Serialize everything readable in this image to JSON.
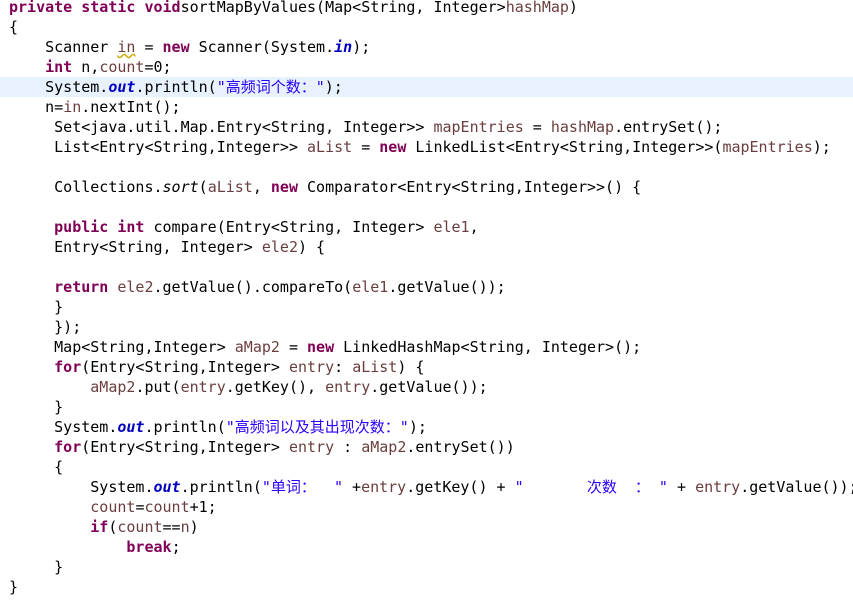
{
  "editor": {
    "current_line_index": 4,
    "colors": {
      "background": "#ffffff",
      "current_line_highlight": "#e8f2fe",
      "keyword": "#7f0055",
      "local_variable": "#6a3e3e",
      "static_field": "#0000c0",
      "string": "#2a00ff",
      "default_text": "#000000",
      "warning_underline": "#c9a800"
    },
    "lines": [
      [
        [
          "kw",
          "private"
        ],
        [
          "",
          "static"
        ],
        [
          "",
          ""
        ],
        [
          "kw",
          "void"
        ],
        [
          "",
          "sortMapByValues(Map<String, Integer>"
        ],
        [
          "var",
          "hashMap"
        ],
        [
          "",
          ")"
        ]
      ],
      [
        [
          "",
          "{"
        ]
      ],
      [
        [
          "",
          "    Scanner "
        ],
        [
          "var warn",
          "in"
        ],
        [
          "",
          " = "
        ],
        [
          "kw",
          "new"
        ],
        [
          "",
          " Scanner(System."
        ],
        [
          "fld",
          "in"
        ],
        [
          "",
          ");"
        ]
      ],
      [
        [
          "",
          "    "
        ],
        [
          "kw",
          "int"
        ],
        [
          "",
          " n,"
        ],
        [
          "var",
          "count"
        ],
        [
          "",
          "=0;"
        ]
      ],
      [
        [
          "",
          "    System."
        ],
        [
          "fld",
          "out"
        ],
        [
          "",
          ".println("
        ],
        [
          "str",
          "\"高频词个数：\""
        ],
        [
          "",
          ");"
        ]
      ],
      [
        [
          "",
          "    n="
        ],
        [
          "var",
          "in"
        ],
        [
          "",
          ".nextInt();"
        ]
      ],
      [
        [
          "",
          "     Set<java.util.Map.Entry<String, Integer>> "
        ],
        [
          "var",
          "mapEntries"
        ],
        [
          "",
          " = "
        ],
        [
          "var",
          "hashMap"
        ],
        [
          "",
          ".entrySet();"
        ]
      ],
      [
        [
          "",
          "     List<Entry<String,Integer>> "
        ],
        [
          "var",
          "aList"
        ],
        [
          "",
          " = "
        ],
        [
          "kw",
          "new"
        ],
        [
          "",
          " LinkedList<Entry<String,Integer>>("
        ],
        [
          "var",
          "mapEntries"
        ],
        [
          "",
          ");"
        ]
      ],
      [
        [
          "",
          ""
        ]
      ],
      [
        [
          "",
          "     Collections."
        ],
        [
          "sm",
          "sort"
        ],
        [
          "",
          "("
        ],
        [
          "var",
          "aList"
        ],
        [
          "",
          ", "
        ],
        [
          "kw",
          "new"
        ],
        [
          "",
          " Comparator<Entry<String,Integer>>() {"
        ]
      ],
      [
        [
          "",
          ""
        ]
      ],
      [
        [
          "",
          "     "
        ],
        [
          "kw",
          "public"
        ],
        [
          "",
          ""
        ],
        [
          "kw",
          "int"
        ],
        [
          "",
          " compare(Entry<String, Integer> "
        ],
        [
          "var",
          "ele1"
        ],
        [
          "",
          ","
        ]
      ],
      [
        [
          "",
          "     Entry<String, Integer> "
        ],
        [
          "var",
          "ele2"
        ],
        [
          "",
          ") {"
        ]
      ],
      [
        [
          "",
          ""
        ]
      ],
      [
        [
          "",
          "     "
        ],
        [
          "kw",
          "return"
        ],
        [
          "",
          " "
        ],
        [
          "var",
          "ele2"
        ],
        [
          "",
          ".getValue().compareTo("
        ],
        [
          "var",
          "ele1"
        ],
        [
          "",
          ".getValue());"
        ]
      ],
      [
        [
          "",
          "     }"
        ]
      ],
      [
        [
          "",
          "     });"
        ]
      ],
      [
        [
          "",
          "     Map<String,Integer> "
        ],
        [
          "var",
          "aMap2"
        ],
        [
          "",
          " = "
        ],
        [
          "kw",
          "new"
        ],
        [
          "",
          " LinkedHashMap<String, Integer>();"
        ]
      ],
      [
        [
          "",
          "     "
        ],
        [
          "kw",
          "for"
        ],
        [
          "",
          "(Entry<String,Integer> "
        ],
        [
          "var",
          "entry"
        ],
        [
          "",
          ": "
        ],
        [
          "var",
          "aList"
        ],
        [
          "",
          ") {"
        ]
      ],
      [
        [
          "",
          "         "
        ],
        [
          "var",
          "aMap2"
        ],
        [
          "",
          ".put("
        ],
        [
          "var",
          "entry"
        ],
        [
          "",
          ".getKey(), "
        ],
        [
          "var",
          "entry"
        ],
        [
          "",
          ".getValue());"
        ]
      ],
      [
        [
          "",
          "     }"
        ]
      ],
      [
        [
          "",
          "     System."
        ],
        [
          "fld",
          "out"
        ],
        [
          "",
          ".println("
        ],
        [
          "str",
          "\"高频词以及其出现次数：\""
        ],
        [
          "",
          ");"
        ]
      ],
      [
        [
          "",
          "     "
        ],
        [
          "kw",
          "for"
        ],
        [
          "",
          "(Entry<String,Integer> "
        ],
        [
          "var",
          "entry"
        ],
        [
          "",
          " : "
        ],
        [
          "var",
          "aMap2"
        ],
        [
          "",
          ".entrySet())"
        ]
      ],
      [
        [
          "",
          "     {"
        ]
      ],
      [
        [
          "",
          "         System."
        ],
        [
          "fld",
          "out"
        ],
        [
          "",
          ".println("
        ],
        [
          "str",
          "\"单词：  \""
        ],
        [
          "",
          " +"
        ],
        [
          "var",
          "entry"
        ],
        [
          "",
          ".getKey() + "
        ],
        [
          "str",
          "\"       次数  ： \""
        ],
        [
          "",
          " + "
        ],
        [
          "var",
          "entry"
        ],
        [
          "",
          ".getValue());"
        ]
      ],
      [
        [
          "",
          "         "
        ],
        [
          "var",
          "count"
        ],
        [
          "",
          "="
        ],
        [
          "var",
          "count"
        ],
        [
          "",
          "+1;"
        ]
      ],
      [
        [
          "",
          "         "
        ],
        [
          "kw",
          "if"
        ],
        [
          "",
          "("
        ],
        [
          "var",
          "count"
        ],
        [
          "",
          "=="
        ],
        [
          "var",
          "n"
        ],
        [
          "",
          ")"
        ]
      ],
      [
        [
          "",
          "             "
        ],
        [
          "kw",
          "break"
        ],
        [
          "",
          ";"
        ]
      ],
      [
        [
          "",
          "     }"
        ]
      ],
      [
        [
          "",
          "}"
        ]
      ]
    ]
  }
}
